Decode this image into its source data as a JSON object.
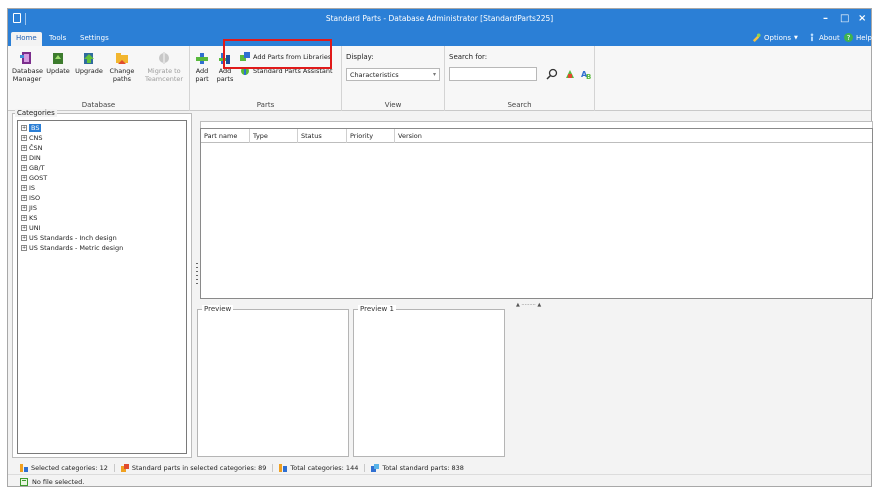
{
  "window": {
    "title": "Standard Parts - Database Administrator [StandardParts225]",
    "minimize": "–",
    "maximize": "□",
    "close": "×"
  },
  "menu": {
    "tabs": [
      "Home",
      "Tools",
      "Settings"
    ],
    "options": "Options",
    "about": "About",
    "help": "Help"
  },
  "ribbon": {
    "database": {
      "label": "Database",
      "manager_line1": "Database",
      "manager_line2": "Manager",
      "update": "Update",
      "upgrade": "Upgrade",
      "change_line1": "Change",
      "change_line2": "paths",
      "migrate_line1": "Migrate to",
      "migrate_line2": "Teamcenter"
    },
    "parts": {
      "label": "Parts",
      "add_part_line1": "Add",
      "add_part_line2": "part",
      "add_parts_line1": "Add",
      "add_parts_line2": "parts",
      "add_from_libraries": "Add Parts from Libraries",
      "assistant": "Standard Parts Assistant"
    },
    "view": {
      "label": "View",
      "display_label": "Display:",
      "display_value": "Characteristics"
    },
    "search": {
      "label": "Search",
      "search_for": "Search for:",
      "value": ""
    }
  },
  "categories": {
    "title": "Categories",
    "items": [
      "BS",
      "CNS",
      "ČSN",
      "DIN",
      "GB/T",
      "GOST",
      "IS",
      "ISO",
      "JIS",
      "KS",
      "UNI",
      "US Standards - Inch design",
      "US Standards - Metric design"
    ],
    "selected_index": 0
  },
  "grid": {
    "columns": [
      "Part name",
      "Type",
      "Status",
      "Priority",
      "Version"
    ]
  },
  "previews": [
    "Preview",
    "Preview 1"
  ],
  "status": {
    "selected_categories": "Selected categories:  12",
    "standard_parts_in_selected": "Standard parts in selected categories:  89",
    "total_categories": "Total categories:  144",
    "total_standard_parts": "Total standard parts:  838",
    "file": "No file selected."
  },
  "colors": {
    "accent": "#2b7fd6",
    "highlight": "#e01a1a"
  }
}
